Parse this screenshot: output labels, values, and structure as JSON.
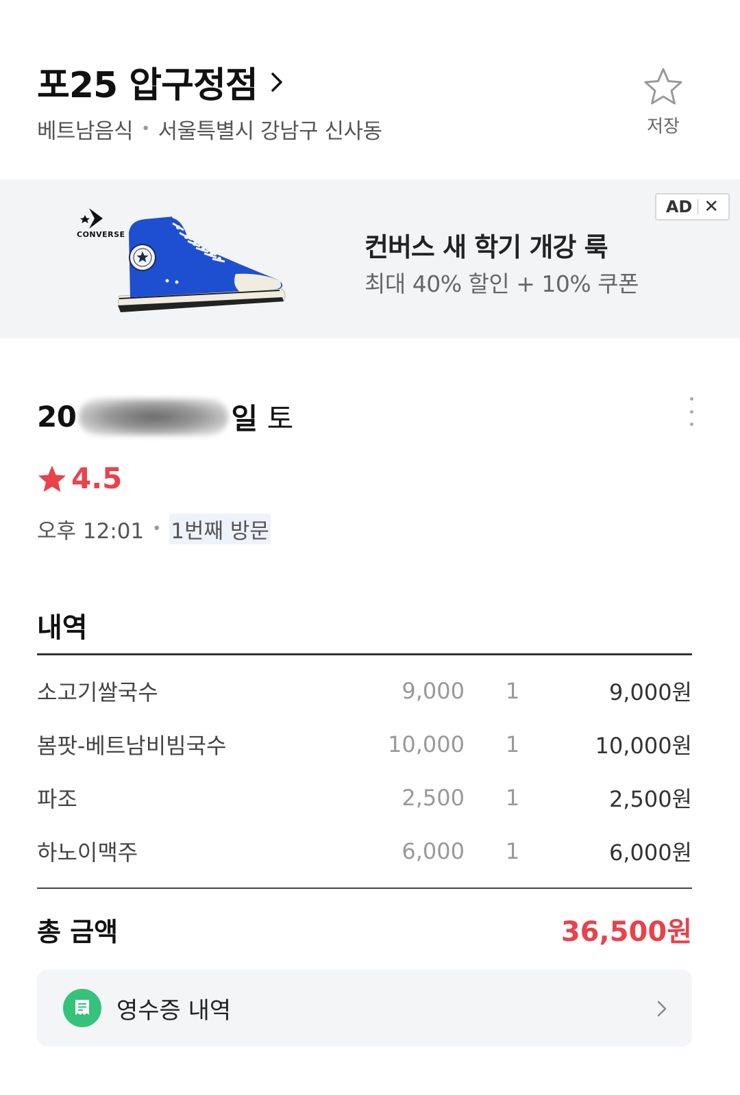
{
  "store": {
    "name": "포25 압구정점",
    "category": "베트남음식",
    "address": "서울특별시 강남구 신사동",
    "save_label": "저장"
  },
  "ad": {
    "badge": "AD",
    "close": "✕",
    "brand": "CONVERSE",
    "title": "컨버스 새 학기 개강 룩",
    "subtitle": "최대 40% 할인 + 10% 쿠폰"
  },
  "visit": {
    "date_prefix": "20",
    "date_suffix": "일",
    "weekday": "토",
    "rating": "4.5",
    "time": "오후 12:01",
    "visit_count": "1번째 방문"
  },
  "order": {
    "title": "내역",
    "items": [
      {
        "name": "소고기쌀국수",
        "price": "9,000",
        "qty": "1",
        "amount": "9,000원"
      },
      {
        "name": "봄팟-베트남비빔국수",
        "price": "10,000",
        "qty": "1",
        "amount": "10,000원"
      },
      {
        "name": "파조",
        "price": "2,500",
        "qty": "1",
        "amount": "2,500원"
      },
      {
        "name": "하노이맥주",
        "price": "6,000",
        "qty": "1",
        "amount": "6,000원"
      }
    ],
    "total_label": "총 금액",
    "total_value": "36,500원"
  },
  "receipt": {
    "label": "영수증 내역"
  },
  "colors": {
    "accent_red": "#e8424b",
    "receipt_green": "#35c27a",
    "ad_bg": "#f3f4f6",
    "shoe_blue": "#1e4fd0"
  }
}
